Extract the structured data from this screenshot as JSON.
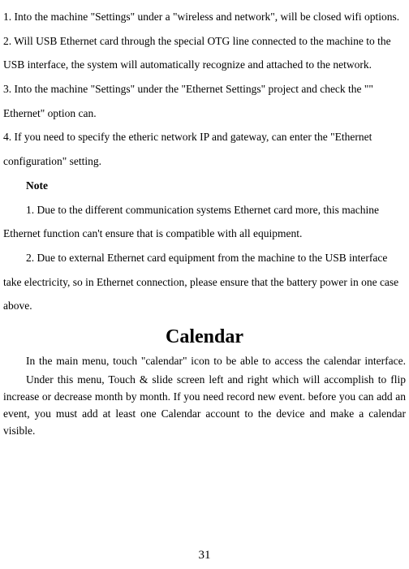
{
  "steps": {
    "s1": "1. Into the machine \"Settings\" under a \"wireless and network\", will be closed wifi options.",
    "s2": "2. Will USB Ethernet card through the special OTG line connected to the machine to the USB interface, the system will automatically recognize and attached to the network.",
    "s3": "3. Into the machine \"Settings\" under the \"Ethernet Settings\" project and check the \"\" Ethernet\" option can.",
    "s4": "4. If you need to specify the etheric network IP and gateway, can enter the \"Ethernet configuration\" setting."
  },
  "note": {
    "heading": "Note",
    "n1": "1. Due to the different communication systems Ethernet card more, this machine Ethernet function can't ensure that is compatible with all equipment.",
    "n2": "2. Due to external Ethernet card equipment from the machine to the USB interface take electricity, so in Ethernet connection, please ensure that the battery power in one case above."
  },
  "calendar": {
    "title": "Calendar",
    "p1": "In the main menu, touch \"calendar\" icon to be able to access the calendar interface.",
    "p2": "Under this menu, Touch & slide screen left and right which will accomplish to flip increase or decrease month by month. If you need record new event. before you can add an event, you must add at least one Calendar account to the device and make a calendar visible."
  },
  "pageNumber": "31"
}
